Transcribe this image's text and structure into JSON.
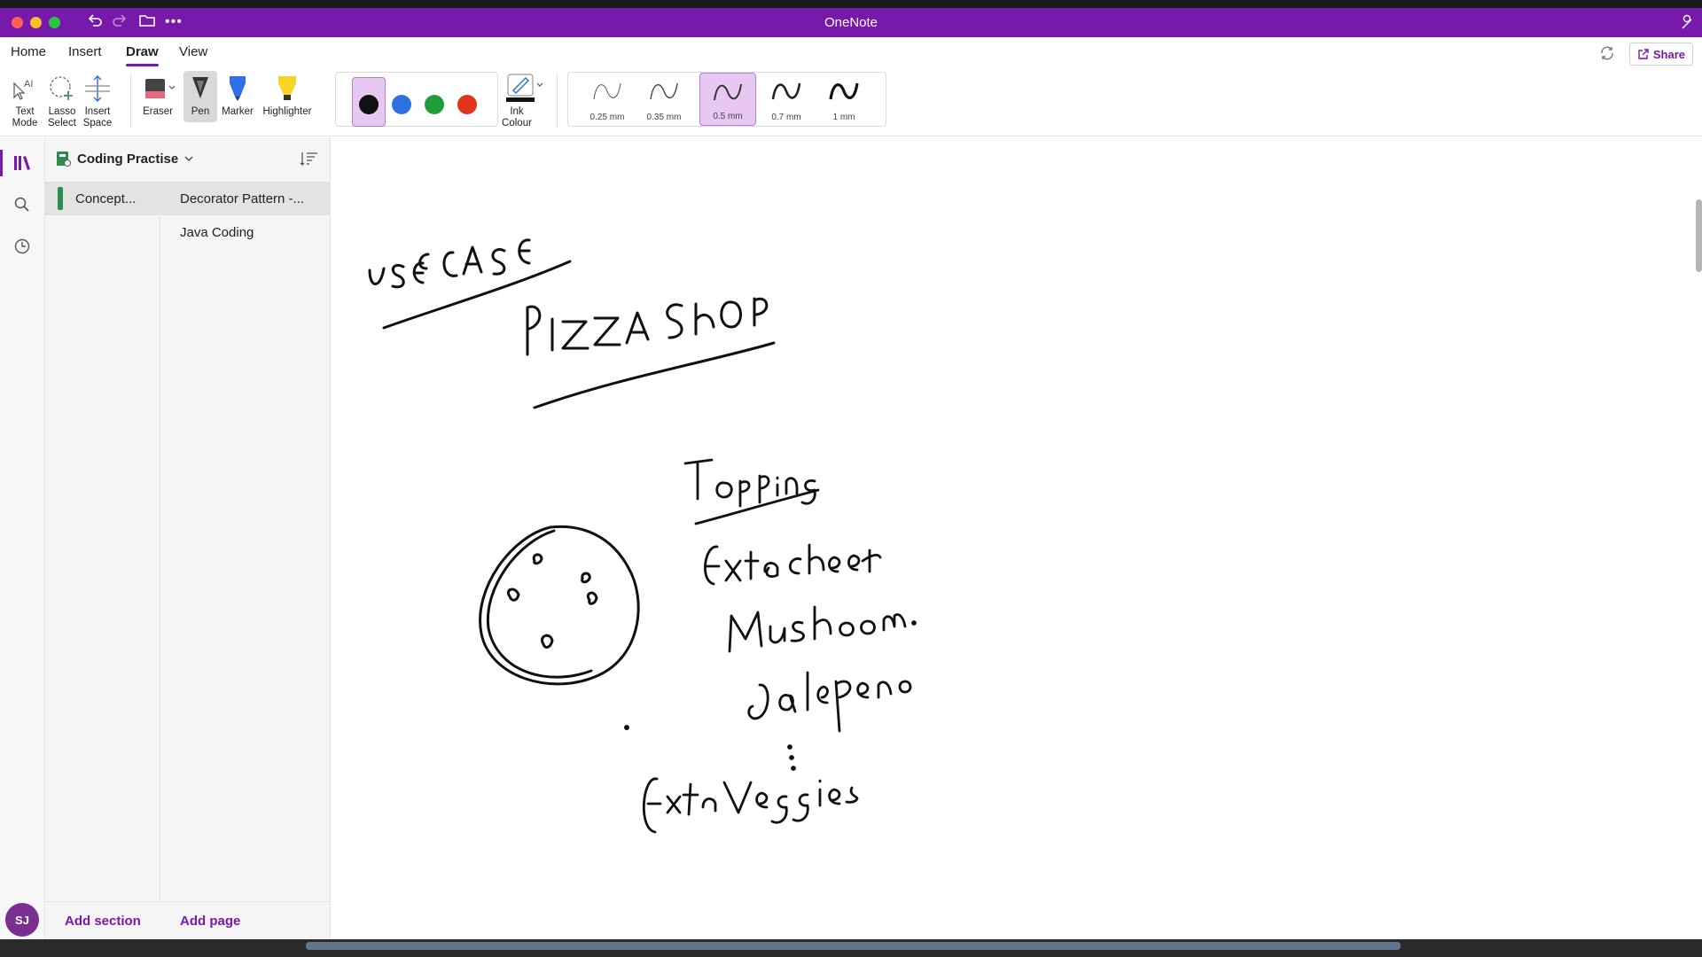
{
  "window": {
    "title": "OneNote"
  },
  "menu": {
    "tabs": [
      "Home",
      "Insert",
      "Draw",
      "View"
    ],
    "active_tab": "Draw",
    "share_label": "Share"
  },
  "ribbon": {
    "tools": {
      "text_mode": "Text Mode",
      "lasso_select": "Lasso Select",
      "insert_space": "Insert Space",
      "eraser": "Eraser",
      "pen": "Pen",
      "marker": "Marker",
      "highlighter": "Highlighter",
      "ink_colour": "Ink Colour"
    },
    "pen_colors": [
      "#111111",
      "#2f6fe4",
      "#1f9e3b",
      "#e0341e"
    ],
    "selected_color": "#111111",
    "thickness": [
      "0.25 mm",
      "0.35 mm",
      "0.5 mm",
      "0.7 mm",
      "1 mm"
    ],
    "selected_thickness": "0.5 mm"
  },
  "sidebar": {
    "notebook_name": "Coding Practise",
    "sections": [
      {
        "label": "Concept...",
        "color": "#2c8c4b"
      }
    ],
    "pages": [
      {
        "label": "Decorator Pattern -...",
        "active": true
      },
      {
        "label": "Java Coding",
        "active": false
      }
    ],
    "add_section": "Add section",
    "add_page": "Add page",
    "avatar_initials": "SJ"
  },
  "canvas": {
    "handwriting": [
      "USE CASE",
      "PIZZA SHOP",
      "Toppings",
      "Extra cheese",
      "Mushroom.",
      "Jalapeno",
      "Extra Veggies"
    ]
  },
  "colors": {
    "brand": "#7719aa",
    "titlebar": "#7719aa",
    "selection": "#e6c8f2"
  }
}
